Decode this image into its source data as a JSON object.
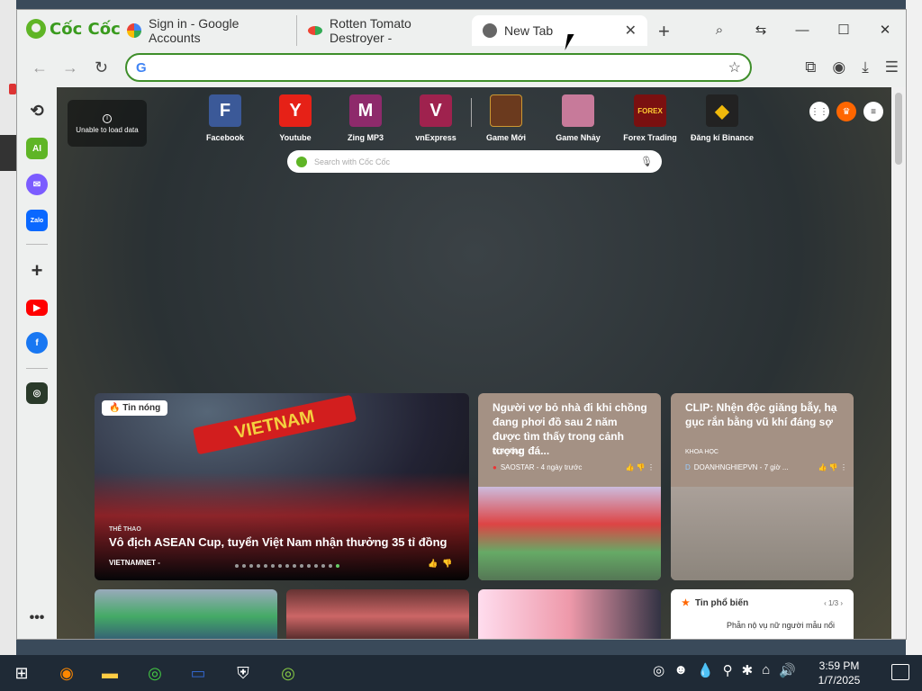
{
  "browser": {
    "logo_text": "Cốc Cốc",
    "tabs": [
      {
        "title": "Sign in - Google Accounts"
      },
      {
        "title": "Rotten Tomato Destroyer -"
      },
      {
        "title": "New Tab",
        "close": "✕"
      }
    ],
    "new_tab_symbol": "+",
    "address_value": "",
    "window_controls": {
      "minimize": "—",
      "maximize": "☐",
      "close": "✕"
    }
  },
  "newtab": {
    "unable_text": "Unable to load data",
    "speed_dials": [
      {
        "label": "Facebook",
        "letter": "F",
        "color": "#3b5998"
      },
      {
        "label": "Youtube",
        "letter": "Y",
        "color": "#e62117"
      },
      {
        "label": "Zing MP3",
        "letter": "M",
        "color": "#8e2a6b"
      },
      {
        "label": "vnExpress",
        "letter": "V",
        "color": "#9f224e"
      },
      {
        "label": "Game Mới",
        "letter": "",
        "color": "#6b3a1e"
      },
      {
        "label": "Game Nhảy",
        "letter": "",
        "color": "#c77a9a"
      },
      {
        "label": "Forex Trading",
        "letter": "FOREX",
        "color": "#7a1010"
      },
      {
        "label": "Đăng kí Binance",
        "letter": "◆",
        "color": "#222"
      }
    ],
    "search_placeholder": "Search with Cốc Cốc"
  },
  "news": {
    "hero": {
      "tag": "Tin nóng",
      "scarf": "VIETNAM",
      "category": "THỂ THAO",
      "title": "Vô địch ASEAN Cup, tuyển Việt Nam nhận thưởng 35 tỉ đồng",
      "source": "VIETNAMNET -"
    },
    "cards": [
      {
        "title": "Người vợ bỏ nhà đi khi chồng đang phơi đồ sau 2 năm được tìm thấy trong cảnh tượng đá...",
        "category": "ĐỜI SỐNG",
        "source": "SAOSTAR - 4 ngày trước"
      },
      {
        "title": "CLIP: Nhện độc giăng bẫy, hạ gục rắn bằng vũ khí đáng sợ",
        "category": "KHOA HỌC",
        "source": "DOANHNGHIEPVN - 7 giờ ..."
      }
    ],
    "popular": {
      "heading": "Tin phổ biến",
      "page": "1/3",
      "item": "Phẫn nộ vụ nữ người mẫu nổi"
    }
  },
  "taskbar": {
    "time": "3:59 PM",
    "date": "1/7/2025"
  }
}
